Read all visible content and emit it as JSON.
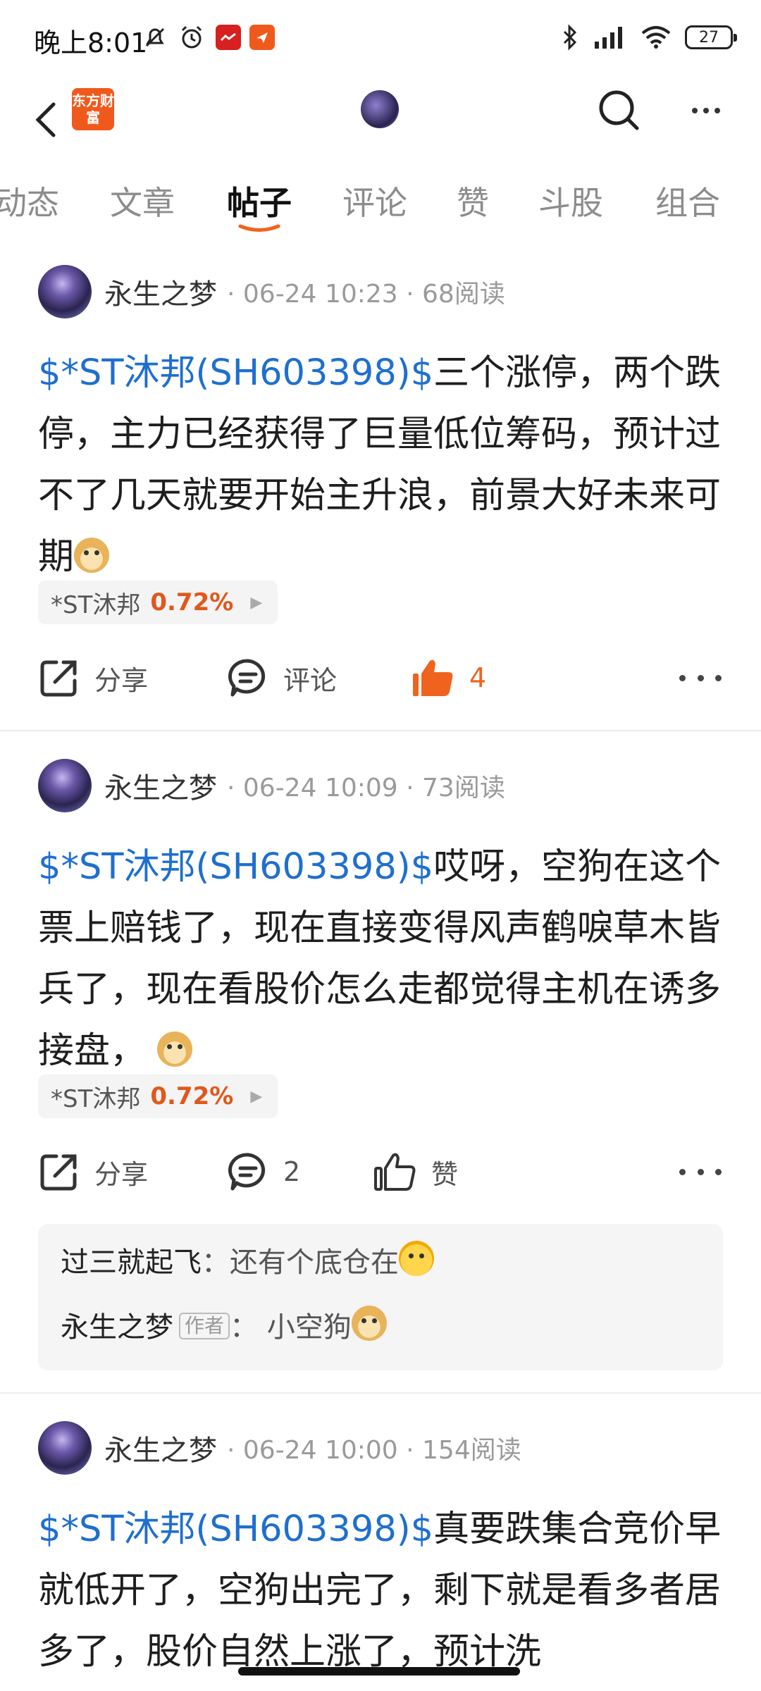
{
  "status_bar": {
    "time": "晚上8:01",
    "battery": "27"
  },
  "header": {
    "logo_text": "东方财富"
  },
  "tabs": [
    "动态",
    "文章",
    "帖子",
    "评论",
    "赞",
    "斗股",
    "组合"
  ],
  "active_tab": "帖子",
  "posts": [
    {
      "author": "永生之梦",
      "meta": "· 06-24 10:23 · 68阅读",
      "stock_link": "$*ST沐邦(SH603398)$",
      "text": "三个涨停，两个跌停，主力已经获得了巨量低位筹码，预计过不了几天就要开始主升浪，前景大好未来可期",
      "stock_tag": {
        "name": "*ST沐邦",
        "change": "0.72%"
      },
      "actions": {
        "share": "分享",
        "comment": "评论",
        "like": "4"
      }
    },
    {
      "author": "永生之梦",
      "meta": "· 06-24 10:09 · 73阅读",
      "stock_link": "$*ST沐邦(SH603398)$",
      "text": "哎呀，空狗在这个票上赔钱了，现在直接变得风声鹤唳草木皆兵了，现在看股价怎么走都觉得主机在诱多接盘，",
      "stock_tag": {
        "name": "*ST沐邦",
        "change": "0.72%"
      },
      "actions": {
        "share": "分享",
        "comment": "2",
        "like": "赞"
      },
      "comments": [
        {
          "user": "过三就起飞",
          "sep": "：",
          "text": "还有个底仓在"
        },
        {
          "user": "永生之梦",
          "badge": "作者",
          "sep": "：",
          "text": "小空狗"
        }
      ]
    },
    {
      "author": "永生之梦",
      "meta": "· 06-24 10:00 · 154阅读",
      "stock_link": "$*ST沐邦(SH603398)$",
      "text": "真要跌集合竞价早就低开了，空狗出完了，剩下就是看多者居多了，股价自然上涨了，预计洗"
    }
  ],
  "colors": {
    "brand": "#ef5a1c",
    "link": "#1f6fce",
    "like_active": "#f0631e",
    "stock_up": "#e0581b"
  },
  "icons": [
    "back-icon",
    "search-icon",
    "more-icon",
    "share-icon",
    "comment-icon",
    "thumbs-up-icon"
  ]
}
